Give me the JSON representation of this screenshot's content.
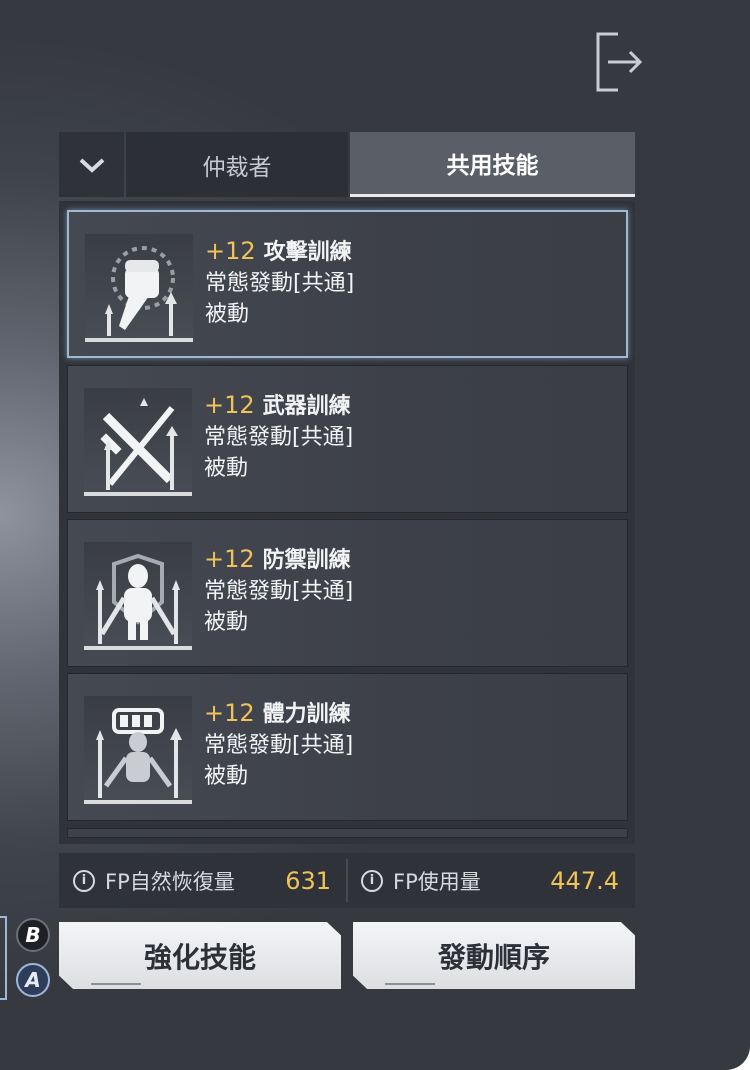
{
  "header": {
    "exit_icon": "exit-arrow-icon"
  },
  "tabs": {
    "dropdown_icon": "chevron-down-icon",
    "arbiter_label": "仲裁者",
    "common_label": "共用技能"
  },
  "skills": [
    {
      "level": "+12",
      "name": "攻擊訓練",
      "trigger": "常態發動[共通]",
      "type": "被動",
      "icon": "fist-icon"
    },
    {
      "level": "+12",
      "name": "武器訓練",
      "trigger": "常態發動[共通]",
      "type": "被動",
      "icon": "crossed-weapons-icon"
    },
    {
      "level": "+12",
      "name": "防禦訓練",
      "trigger": "常態發動[共通]",
      "type": "被動",
      "icon": "armor-shield-icon"
    },
    {
      "level": "+12",
      "name": "體力訓練",
      "trigger": "常態發動[共通]",
      "type": "被動",
      "icon": "battery-body-icon"
    }
  ],
  "fp": {
    "recover_label": "FP自然恢復量",
    "recover_value": "631",
    "use_label": "FP使用量",
    "use_value": "447.4",
    "info_icon_text": "i"
  },
  "buttons": {
    "enhance_label": "強化技能",
    "order_label": "發動順序"
  },
  "controller": {
    "b_label": "B",
    "a_label": "A"
  },
  "colors": {
    "accent_gold": "#f0c35a",
    "selected_border": "#9eb8d8"
  }
}
